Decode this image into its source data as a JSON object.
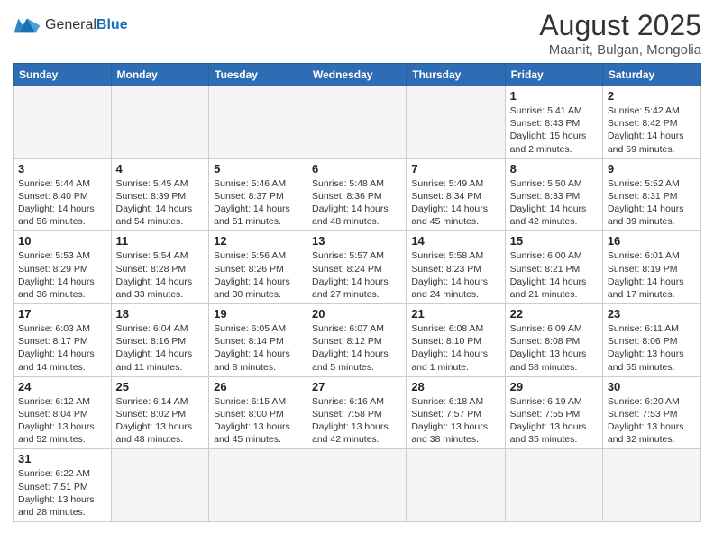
{
  "header": {
    "logo_general": "General",
    "logo_blue": "Blue",
    "month_title": "August 2025",
    "location": "Maanit, Bulgan, Mongolia"
  },
  "weekdays": [
    "Sunday",
    "Monday",
    "Tuesday",
    "Wednesday",
    "Thursday",
    "Friday",
    "Saturday"
  ],
  "weeks": [
    [
      {
        "day": "",
        "info": ""
      },
      {
        "day": "",
        "info": ""
      },
      {
        "day": "",
        "info": ""
      },
      {
        "day": "",
        "info": ""
      },
      {
        "day": "",
        "info": ""
      },
      {
        "day": "1",
        "info": "Sunrise: 5:41 AM\nSunset: 8:43 PM\nDaylight: 15 hours\nand 2 minutes."
      },
      {
        "day": "2",
        "info": "Sunrise: 5:42 AM\nSunset: 8:42 PM\nDaylight: 14 hours\nand 59 minutes."
      }
    ],
    [
      {
        "day": "3",
        "info": "Sunrise: 5:44 AM\nSunset: 8:40 PM\nDaylight: 14 hours\nand 56 minutes."
      },
      {
        "day": "4",
        "info": "Sunrise: 5:45 AM\nSunset: 8:39 PM\nDaylight: 14 hours\nand 54 minutes."
      },
      {
        "day": "5",
        "info": "Sunrise: 5:46 AM\nSunset: 8:37 PM\nDaylight: 14 hours\nand 51 minutes."
      },
      {
        "day": "6",
        "info": "Sunrise: 5:48 AM\nSunset: 8:36 PM\nDaylight: 14 hours\nand 48 minutes."
      },
      {
        "day": "7",
        "info": "Sunrise: 5:49 AM\nSunset: 8:34 PM\nDaylight: 14 hours\nand 45 minutes."
      },
      {
        "day": "8",
        "info": "Sunrise: 5:50 AM\nSunset: 8:33 PM\nDaylight: 14 hours\nand 42 minutes."
      },
      {
        "day": "9",
        "info": "Sunrise: 5:52 AM\nSunset: 8:31 PM\nDaylight: 14 hours\nand 39 minutes."
      }
    ],
    [
      {
        "day": "10",
        "info": "Sunrise: 5:53 AM\nSunset: 8:29 PM\nDaylight: 14 hours\nand 36 minutes."
      },
      {
        "day": "11",
        "info": "Sunrise: 5:54 AM\nSunset: 8:28 PM\nDaylight: 14 hours\nand 33 minutes."
      },
      {
        "day": "12",
        "info": "Sunrise: 5:56 AM\nSunset: 8:26 PM\nDaylight: 14 hours\nand 30 minutes."
      },
      {
        "day": "13",
        "info": "Sunrise: 5:57 AM\nSunset: 8:24 PM\nDaylight: 14 hours\nand 27 minutes."
      },
      {
        "day": "14",
        "info": "Sunrise: 5:58 AM\nSunset: 8:23 PM\nDaylight: 14 hours\nand 24 minutes."
      },
      {
        "day": "15",
        "info": "Sunrise: 6:00 AM\nSunset: 8:21 PM\nDaylight: 14 hours\nand 21 minutes."
      },
      {
        "day": "16",
        "info": "Sunrise: 6:01 AM\nSunset: 8:19 PM\nDaylight: 14 hours\nand 17 minutes."
      }
    ],
    [
      {
        "day": "17",
        "info": "Sunrise: 6:03 AM\nSunset: 8:17 PM\nDaylight: 14 hours\nand 14 minutes."
      },
      {
        "day": "18",
        "info": "Sunrise: 6:04 AM\nSunset: 8:16 PM\nDaylight: 14 hours\nand 11 minutes."
      },
      {
        "day": "19",
        "info": "Sunrise: 6:05 AM\nSunset: 8:14 PM\nDaylight: 14 hours\nand 8 minutes."
      },
      {
        "day": "20",
        "info": "Sunrise: 6:07 AM\nSunset: 8:12 PM\nDaylight: 14 hours\nand 5 minutes."
      },
      {
        "day": "21",
        "info": "Sunrise: 6:08 AM\nSunset: 8:10 PM\nDaylight: 14 hours\nand 1 minute."
      },
      {
        "day": "22",
        "info": "Sunrise: 6:09 AM\nSunset: 8:08 PM\nDaylight: 13 hours\nand 58 minutes."
      },
      {
        "day": "23",
        "info": "Sunrise: 6:11 AM\nSunset: 8:06 PM\nDaylight: 13 hours\nand 55 minutes."
      }
    ],
    [
      {
        "day": "24",
        "info": "Sunrise: 6:12 AM\nSunset: 8:04 PM\nDaylight: 13 hours\nand 52 minutes."
      },
      {
        "day": "25",
        "info": "Sunrise: 6:14 AM\nSunset: 8:02 PM\nDaylight: 13 hours\nand 48 minutes."
      },
      {
        "day": "26",
        "info": "Sunrise: 6:15 AM\nSunset: 8:00 PM\nDaylight: 13 hours\nand 45 minutes."
      },
      {
        "day": "27",
        "info": "Sunrise: 6:16 AM\nSunset: 7:58 PM\nDaylight: 13 hours\nand 42 minutes."
      },
      {
        "day": "28",
        "info": "Sunrise: 6:18 AM\nSunset: 7:57 PM\nDaylight: 13 hours\nand 38 minutes."
      },
      {
        "day": "29",
        "info": "Sunrise: 6:19 AM\nSunset: 7:55 PM\nDaylight: 13 hours\nand 35 minutes."
      },
      {
        "day": "30",
        "info": "Sunrise: 6:20 AM\nSunset: 7:53 PM\nDaylight: 13 hours\nand 32 minutes."
      }
    ],
    [
      {
        "day": "31",
        "info": "Sunrise: 6:22 AM\nSunset: 7:51 PM\nDaylight: 13 hours\nand 28 minutes."
      },
      {
        "day": "",
        "info": ""
      },
      {
        "day": "",
        "info": ""
      },
      {
        "day": "",
        "info": ""
      },
      {
        "day": "",
        "info": ""
      },
      {
        "day": "",
        "info": ""
      },
      {
        "day": "",
        "info": ""
      }
    ]
  ]
}
